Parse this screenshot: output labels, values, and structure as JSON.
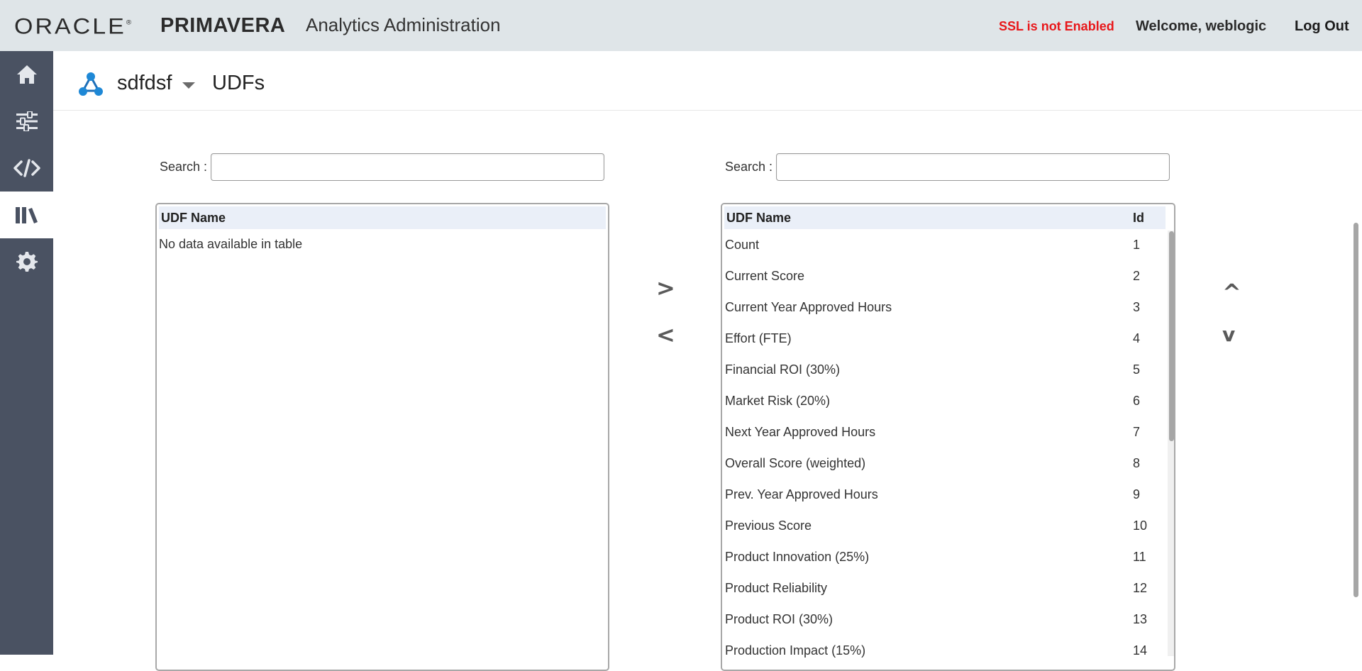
{
  "header": {
    "oracle_logo": "ORACLE",
    "product_logo": "PRIMAVERA",
    "app_title": "Analytics Administration",
    "ssl_status": "SSL is not Enabled",
    "welcome": "Welcome, weblogic",
    "logout_label": "Log Out",
    "ssl_color": "#e8171a",
    "bg_color": "#dfe5e8"
  },
  "sidebar": {
    "bg_color": "#4a5262",
    "items": [
      {
        "icon": "home-icon",
        "active": false
      },
      {
        "icon": "sliders-icon",
        "active": false
      },
      {
        "icon": "code-icon",
        "active": false
      },
      {
        "icon": "library-icon",
        "active": true
      },
      {
        "icon": "gear-icon",
        "active": false
      }
    ]
  },
  "page": {
    "project_name": "sdfdsf",
    "title": "UDFs",
    "project_icon": "network-icon"
  },
  "left_panel": {
    "search_label": "Search :",
    "search_value": "",
    "column_udf_name": "UDF Name",
    "empty_message": "No data available in table"
  },
  "transfer": {
    "move_right": ">",
    "move_left": "<"
  },
  "right_panel": {
    "search_label": "Search :",
    "search_value": "",
    "column_udf_name": "UDF Name",
    "column_id": "Id",
    "rows": [
      {
        "name": "Count",
        "id": "1"
      },
      {
        "name": "Current Score",
        "id": "2"
      },
      {
        "name": "Current Year Approved Hours",
        "id": "3"
      },
      {
        "name": "Effort (FTE)",
        "id": "4"
      },
      {
        "name": "Financial ROI (30%)",
        "id": "5"
      },
      {
        "name": "Market Risk (20%)",
        "id": "6"
      },
      {
        "name": "Next Year Approved Hours",
        "id": "7"
      },
      {
        "name": "Overall Score (weighted)",
        "id": "8"
      },
      {
        "name": "Prev. Year Approved Hours",
        "id": "9"
      },
      {
        "name": "Previous Score",
        "id": "10"
      },
      {
        "name": "Product Innovation (25%)",
        "id": "11"
      },
      {
        "name": "Product Reliability",
        "id": "12"
      },
      {
        "name": "Product ROI (30%)",
        "id": "13"
      },
      {
        "name": "Production Impact (15%)",
        "id": "14"
      }
    ]
  },
  "order": {
    "move_up": "^",
    "move_down": "v"
  }
}
